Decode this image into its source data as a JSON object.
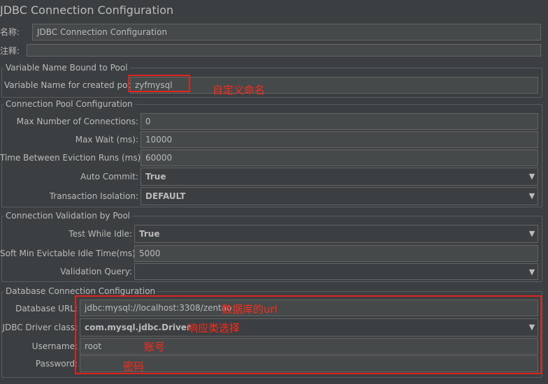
{
  "page": {
    "title": "JDBC Connection Configuration"
  },
  "element": {
    "name_label": "名称:",
    "name_value": "JDBC Connection Configuration",
    "comment_label": "注释:",
    "comment_value": ""
  },
  "variable_group": {
    "title": "Variable Name Bound to Pool",
    "label": "Variable Name for created pool:",
    "value": "zyfmysql"
  },
  "pool_group": {
    "title": "Connection Pool Configuration",
    "max_connections_label": "Max Number of Connections:",
    "max_connections_value": "0",
    "max_wait_label": "Max Wait (ms):",
    "max_wait_value": "10000",
    "eviction_label": "Time Between Eviction Runs (ms):",
    "eviction_value": "60000",
    "auto_commit_label": "Auto Commit:",
    "auto_commit_value": "True",
    "isolation_label": "Transaction Isolation:",
    "isolation_value": "DEFAULT"
  },
  "validation_group": {
    "title": "Connection Validation by Pool",
    "test_idle_label": "Test While Idle:",
    "test_idle_value": "True",
    "soft_min_label": "Soft Min Evictable Idle Time(ms):",
    "soft_min_value": "5000",
    "query_label": "Validation Query:",
    "query_value": ""
  },
  "db_group": {
    "title": "Database Connection Configuration",
    "url_label": "Database URL:",
    "url_value": "jdbc:mysql://localhost:3308/zentao",
    "driver_label": "JDBC Driver class:",
    "driver_value": "com.mysql.jdbc.Driver",
    "username_label": "Username:",
    "username_value": "root",
    "password_label": "Password:",
    "password_value": ""
  },
  "annotations": {
    "custom_name": "自定义命名",
    "db_url": "数据库的url",
    "driver": "响应类选择",
    "account": "账号",
    "password": "密码"
  },
  "icons": {
    "dropdown": "▼"
  },
  "colors": {
    "background": "#3c3f41",
    "annotation_red": "#e0241d"
  }
}
